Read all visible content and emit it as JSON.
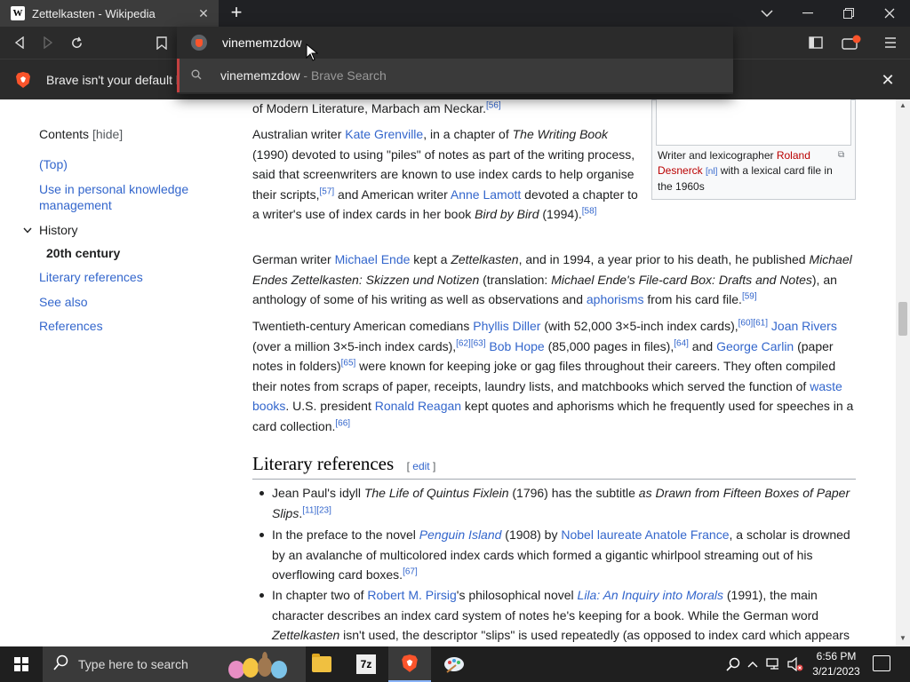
{
  "browser": {
    "tab": {
      "favicon": "W",
      "title": "Zettelkasten - Wikipedia",
      "close": "✕"
    },
    "new_tab": "+",
    "window_controls": {
      "dropdown": "⌄",
      "minimize": "—",
      "restore": "❐",
      "close": "✕"
    },
    "toolbar_icons": [
      "back-icon",
      "forward-icon",
      "reload-icon",
      "bookmark-icon",
      "sidebar-icon",
      "wallet-icon",
      "menu-icon"
    ],
    "omnibox": {
      "value": "vinememzdow",
      "suggestion": {
        "text": "vinememzdow",
        "separator": " - ",
        "source": "Brave Search"
      }
    },
    "infobar": {
      "text": "Brave isn't your default br",
      "close": "✕"
    },
    "colors": {
      "tab_active": "#3c3c3c",
      "chrome": "#2b2b2b",
      "accent": "#fb542b",
      "link": "#3366cc",
      "redlink": "#ba0000"
    }
  },
  "toc": {
    "heading": "Contents",
    "hide_open": "[",
    "hide": "hide",
    "hide_close": "]",
    "items": {
      "top": "(Top)",
      "pkm": "Use in personal knowledge management",
      "history": "History",
      "century": "20th century",
      "literary": "Literary references",
      "see_also": "See also",
      "references": "References"
    }
  },
  "article": {
    "p0": {
      "text": "of Modern Literature, Marbach am Neckar.",
      "ref": "[56]"
    },
    "p1": {
      "a": "Australian writer ",
      "l1": "Kate Grenville",
      "b": ", in a chapter of ",
      "i1": "The Writing Book",
      "c": " (1990) devoted to using \"piles\" of notes as part of the writing process, said that screenwriters are known to use index cards to help organise their scripts,",
      "r1": "[57]",
      "d": " and American writer ",
      "l2": "Anne Lamott",
      "e": " devoted a chapter to a writer's use of index cards in her book ",
      "i2": "Bird by Bird",
      "f": " (1994).",
      "r2": "[58]"
    },
    "p2": {
      "a": "German writer ",
      "l1": "Michael Ende",
      "b": " kept a ",
      "i1": "Zettelkasten",
      "c": ", and in 1994, a year prior to his death, he published ",
      "i2": "Michael Endes Zettelkasten: Skizzen und Notizen",
      "d": " (translation: ",
      "i3": "Michael Ende's File-card Box: Drafts and Notes",
      "e": "), an anthology of some of his writing as well as observations and ",
      "l2": "aphorisms",
      "f": " from his card file.",
      "r1": "[59]"
    },
    "p3": {
      "a": "Twentieth-century American comedians ",
      "l1": "Phyllis Diller",
      "b": " (with 52,000 3×5-inch index cards),",
      "r1": "[60]",
      "r2": "[61]",
      "c": " ",
      "l2": "Joan Rivers",
      "d": " (over a million 3×5-inch index cards),",
      "r3": "[62]",
      "r4": "[63]",
      "e": " ",
      "l3": "Bob Hope",
      "f": " (85,000 pages in files),",
      "r5": "[64]",
      "g": " and ",
      "l4": "George Carlin",
      "h": " (paper notes in folders)",
      "r6": "[65]",
      "i": " were known for keeping joke or gag files throughout their careers. They often compiled their notes from scraps of paper, receipts, laundry lists, and matchbooks which served the function of ",
      "l5": "waste books",
      "j": ". U.S. president ",
      "l6": "Ronald Reagan",
      "k": " kept quotes and aphorisms which he frequently used for speeches in a card collection.",
      "r7": "[66]"
    },
    "figure": {
      "caption_a": "Writer and lexicographer ",
      "caption_link": "Roland Desnerck",
      "caption_nl": "[nl]",
      "caption_b": " with a lexical card file in the 1960s",
      "enlarge": "⧉"
    },
    "section": {
      "title": "Literary references",
      "edit_open": "[ ",
      "edit": "edit",
      "edit_close": " ]"
    },
    "bullets": {
      "b1": {
        "a": "Jean Paul's idyll ",
        "i1": "The Life of Quintus Fixlein",
        "b": " (1796) has the subtitle ",
        "i2": "as Drawn from Fifteen Boxes of Paper Slips",
        "c": ".",
        "r1": "[11]",
        "r2": "[23]"
      },
      "b2": {
        "a": "In the preface to the novel ",
        "l1": "Penguin Island",
        "b": " (1908) by ",
        "l2": "Nobel laureate",
        "c": " ",
        "l3": "Anatole France",
        "d": ", a scholar is drowned by an avalanche of multicolored index cards which formed a gigantic whirlpool streaming out of his overflowing card boxes.",
        "r1": "[67]"
      },
      "b3": {
        "a": "In chapter two of ",
        "l1": "Robert M. Pirsig",
        "b": "'s philosophical novel ",
        "l2": "Lila: An Inquiry into Morals",
        "c": " (1991), the main character describes an index card system of notes he's keeping for a book. While the German word ",
        "i1": "Zettelkasten",
        "d": " isn't used, the descriptor \"slips\" is used repeatedly (as opposed to index card which appears"
      }
    }
  },
  "taskbar": {
    "search_placeholder": "Type here to search",
    "apps": [
      "file-explorer-icon",
      "7zip-icon",
      "brave-icon",
      "paint-icon"
    ],
    "sevenzip_label": "7z",
    "tray_icons": [
      "search-icon",
      "chevron-up-icon",
      "network-icon",
      "volume-muted-icon"
    ],
    "time": "6:56 PM",
    "date": "3/21/2023"
  }
}
